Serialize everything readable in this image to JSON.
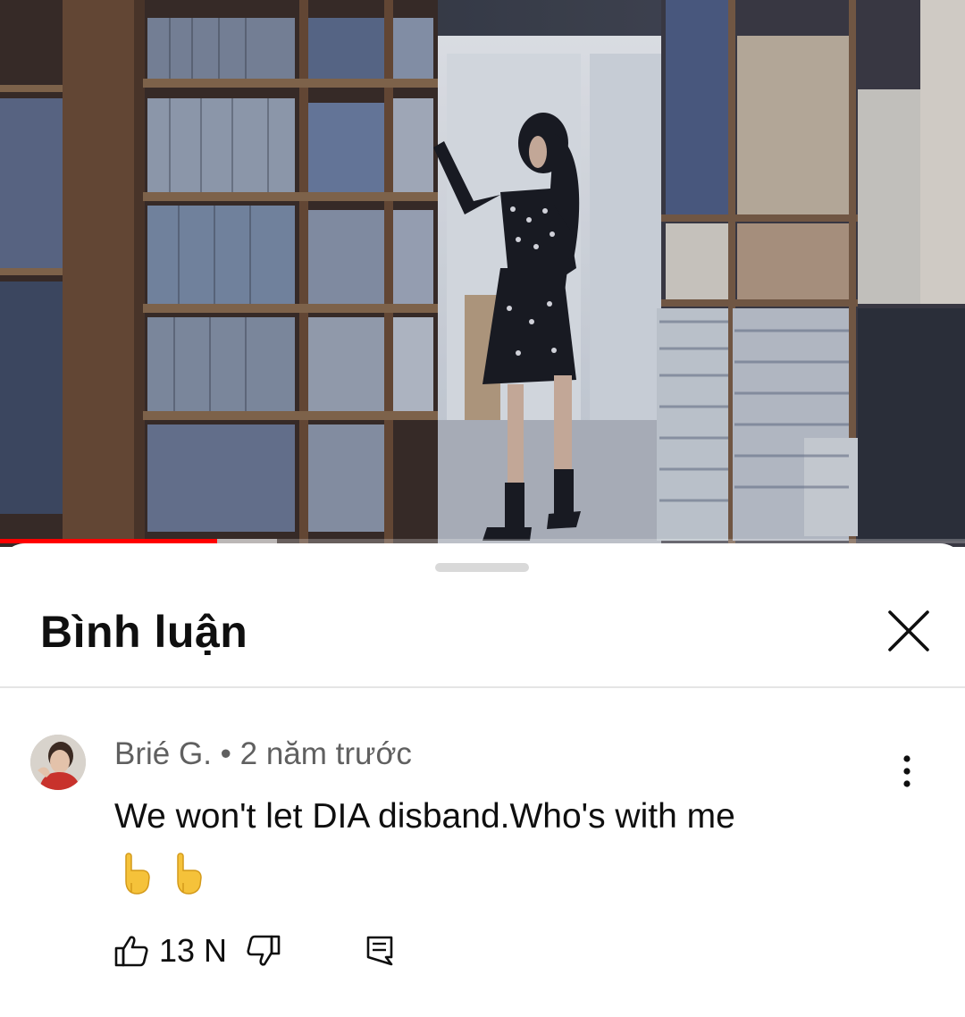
{
  "video": {
    "progress": 0.225,
    "buffered": 0.287,
    "progress_color": "#ff0000"
  },
  "sheet": {
    "title": "Bình luận"
  },
  "comment": {
    "author": "Brié G.",
    "separator": "•",
    "time": "2 năm trước",
    "text": "We won't let DIA disband.Who's with me",
    "emoji": "👇 👇",
    "likes": "13 N"
  },
  "icons": {
    "close": "close-icon",
    "more": "more-vert-icon",
    "like": "thumb-up-icon",
    "dislike": "thumb-down-icon",
    "reply": "reply-icon"
  }
}
